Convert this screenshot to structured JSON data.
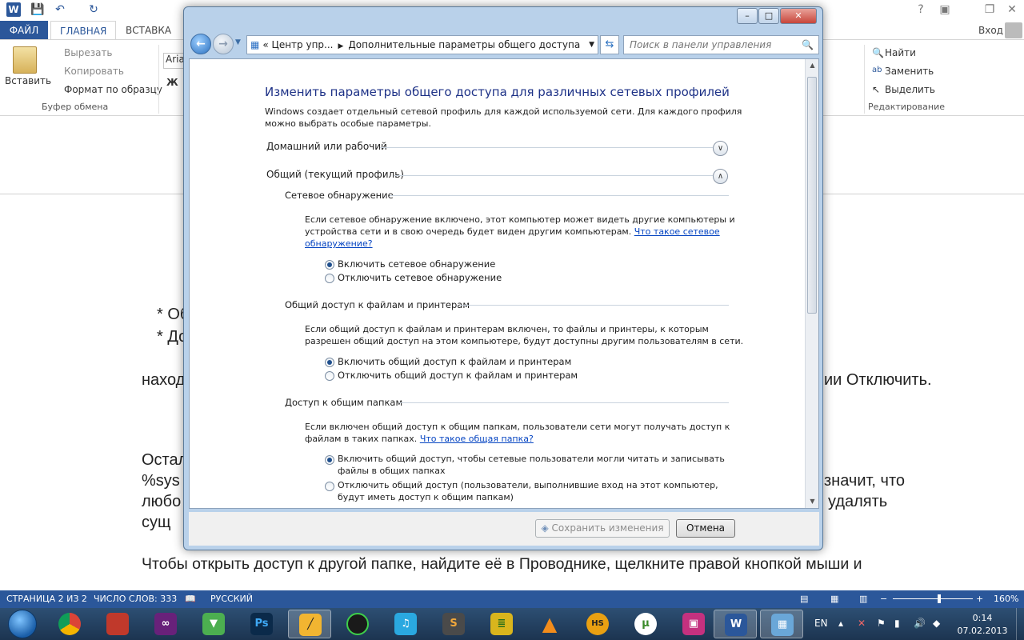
{
  "word": {
    "tabs": [
      "ФАЙЛ",
      "ГЛАВНАЯ",
      "ВСТАВКА"
    ],
    "login": "Вход",
    "clipboard": {
      "paste": "Вставить",
      "cut": "Вырезать",
      "copy": "Копировать",
      "format_painter": "Формат по образцу",
      "group": "Буфер обмена"
    },
    "font_name": "Arial",
    "bold_label": "Ж",
    "editing": {
      "find": "Найти",
      "replace": "Заменить",
      "select": "Выделить",
      "group": "Редактирование"
    },
    "doc_lines": {
      "b1": "* Об",
      "b2": "* До",
      "l1_left": "наход",
      "l1_right": "ии Отключить.",
      "l2_left": "Остал",
      "l3_left": "%sys",
      "l3_right": "значит, что",
      "l4_left": "любо",
      "l4_right": "удалять",
      "l5_left": "сущ",
      "l6": "Чтобы открыть доступ к другой папке, найдите её в Проводнике, щелкните правой кнопкой мыши и"
    },
    "status": {
      "page": "СТРАНИЦА 2 ИЗ 2",
      "words": "ЧИСЛО СЛОВ: 333",
      "lang": "РУССКИЙ",
      "zoom": "160%"
    }
  },
  "dialog": {
    "address": {
      "short": "Центр упр...",
      "current": "Дополнительные параметры общего доступа"
    },
    "search_placeholder": "Поиск в панели управления",
    "title": "Изменить параметры общего доступа для различных сетевых профилей",
    "intro": [
      "Windows создает отдельный сетевой профиль для каждой используемой сети. Для каждого профиля",
      "можно выбрать особые параметры."
    ],
    "profiles": [
      {
        "name": "Домашний или рабочий",
        "expanded": false
      },
      {
        "name": "Общий (текущий профиль)",
        "expanded": true
      }
    ],
    "sections": [
      {
        "title": "Сетевое обнаружение",
        "desc": [
          "Если сетевое обнаружение включено, этот компьютер может видеть другие компьютеры и",
          "устройства сети и в свою очередь будет виден другим компьютерам."
        ],
        "link": [
          "Что такое сетевое",
          "обнаружение?"
        ],
        "options": [
          {
            "label": "Включить сетевое обнаружение",
            "selected": true
          },
          {
            "label": "Отключить сетевое обнаружение",
            "selected": false
          }
        ]
      },
      {
        "title": "Общий доступ к файлам и принтерам",
        "desc": [
          "Если общий доступ к файлам и принтерам включен, то файлы и принтеры, к которым",
          "разрешен общий доступ на этом компьютере, будут доступны другим пользователям в сети."
        ],
        "options": [
          {
            "label": "Включить общий доступ к файлам и принтерам",
            "selected": true
          },
          {
            "label": "Отключить общий доступ к файлам и принтерам",
            "selected": false
          }
        ]
      },
      {
        "title": "Доступ к общим папкам",
        "desc": [
          "Если включен общий доступ к общим папкам, пользователи сети могут получать доступ к",
          "файлам в таких папках."
        ],
        "link": "Что такое общая папка?",
        "options": [
          {
            "label": [
              "Включить общий доступ, чтобы сетевые пользователи могли читать и записывать",
              "файлы в общих папках"
            ],
            "selected": true
          },
          {
            "label": [
              "Отключить общий доступ (пользователи, выполнившие вход на этот компьютер,",
              "будут иметь доступ к общим папкам)"
            ],
            "selected": false
          }
        ]
      }
    ],
    "save_button": "Сохранить изменения",
    "cancel_button": "Отмена"
  },
  "tray": {
    "lang": "EN",
    "time": "0:14",
    "date": "07.02.2013"
  },
  "icons": [
    "word-icon",
    "save-icon",
    "undo-icon",
    "redo-icon",
    "back-icon",
    "forward-icon",
    "search-icon",
    "refresh-icon",
    "shield-icon",
    "chevron-down-icon",
    "chevron-up-icon"
  ],
  "colors": {
    "word_blue": "#2b579a",
    "heading_blue": "#1e3287",
    "link_blue": "#0645c2"
  }
}
